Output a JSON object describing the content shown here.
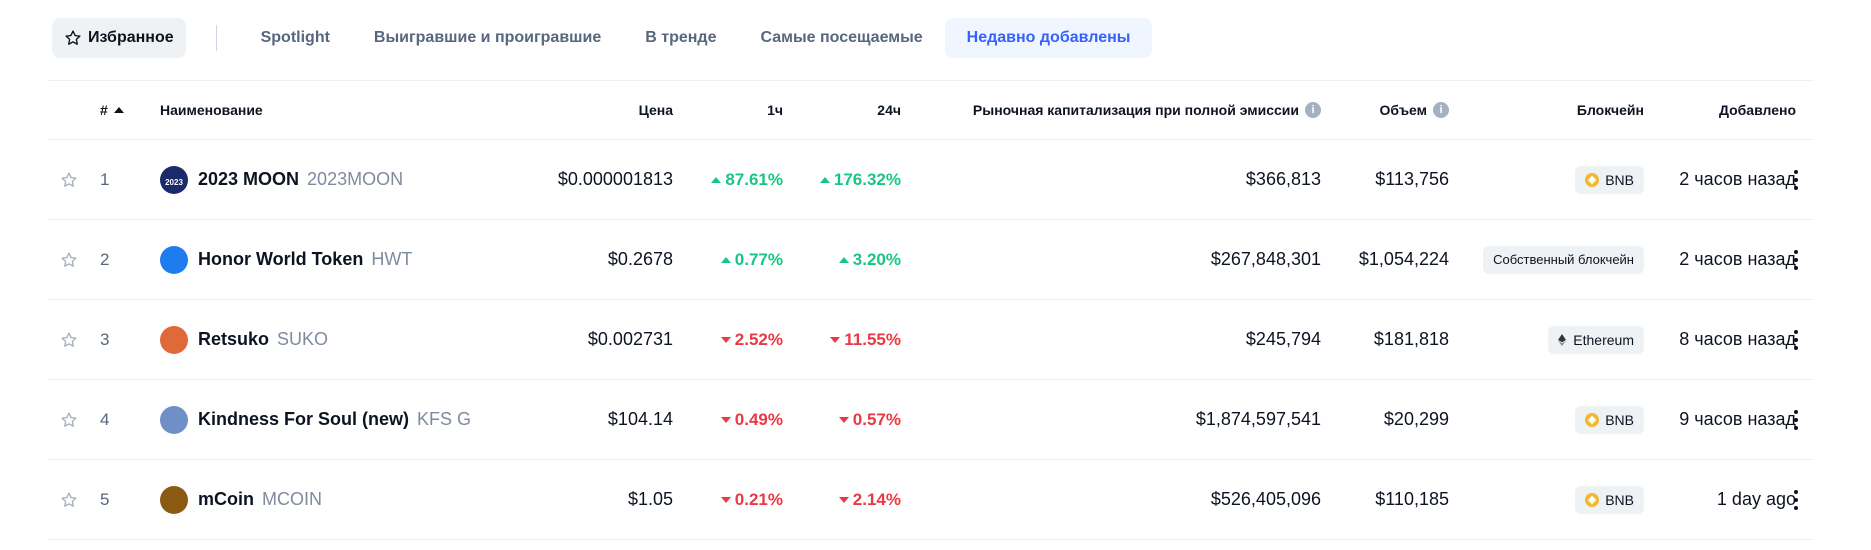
{
  "tabs": [
    {
      "label": "Избранное",
      "icon": "star-icon"
    },
    {
      "label": "Spotlight"
    },
    {
      "label": "Выигравшие и проигравшие"
    },
    {
      "label": "В тренде"
    },
    {
      "label": "Самые посещаемые"
    },
    {
      "label": "Недавно добавлены",
      "active": true
    }
  ],
  "table": {
    "headers": {
      "rank": "#",
      "name": "Наименование",
      "price": "Цена",
      "h1": "1ч",
      "h24": "24ч",
      "fdv": "Рыночная капитализация при полной эмиссии",
      "volume": "Объем",
      "blockchain": "Блокчейн",
      "added": "Добавлено"
    },
    "rows": [
      {
        "rank": "1",
        "name": "2023 MOON",
        "symbol": "2023MOON",
        "price": "$0.000001813",
        "h1": "87.61%",
        "h1_dir": "up",
        "h24": "176.32%",
        "h24_dir": "up",
        "fdv": "$366,813",
        "volume": "$113,756",
        "chain": "BNB",
        "chain_icon": "bnb-icon",
        "added": "2 часов назад",
        "icon_color": "#1a2a6b",
        "icon_text": "2023"
      },
      {
        "rank": "2",
        "name": "Honor World Token",
        "symbol": "HWT",
        "price": "$0.2678",
        "h1": "0.77%",
        "h1_dir": "up",
        "h24": "3.20%",
        "h24_dir": "up",
        "fdv": "$267,848,301",
        "volume": "$1,054,224",
        "chain": "Собственный блокчейн",
        "chain_icon": "",
        "added": "2 часов назад",
        "icon_color": "#1e7bf0",
        "icon_text": ""
      },
      {
        "rank": "3",
        "name": "Retsuko",
        "symbol": "SUKO",
        "price": "$0.002731",
        "h1": "2.52%",
        "h1_dir": "down",
        "h24": "11.55%",
        "h24_dir": "down",
        "fdv": "$245,794",
        "volume": "$181,818",
        "chain": "Ethereum",
        "chain_icon": "ethereum-icon",
        "added": "8 часов назад",
        "icon_color": "#e0693a",
        "icon_text": ""
      },
      {
        "rank": "4",
        "name": "Kindness For Soul (new)",
        "symbol": "KFS G",
        "price": "$104.14",
        "h1": "0.49%",
        "h1_dir": "down",
        "h24": "0.57%",
        "h24_dir": "down",
        "fdv": "$1,874,597,541",
        "volume": "$20,299",
        "chain": "BNB",
        "chain_icon": "bnb-icon",
        "added": "9 часов назад",
        "icon_color": "#6f8fc7",
        "icon_text": ""
      },
      {
        "rank": "5",
        "name": "mCoin",
        "symbol": "MCOIN",
        "price": "$1.05",
        "h1": "0.21%",
        "h1_dir": "down",
        "h24": "2.14%",
        "h24_dir": "down",
        "fdv": "$526,405,096",
        "volume": "$110,185",
        "chain": "BNB",
        "chain_icon": "bnb-icon",
        "added": "1 day ago",
        "icon_color": "#8a5a12",
        "icon_text": ""
      }
    ]
  },
  "colors": {
    "up": "#16c784",
    "down": "#ea3943",
    "accent": "#3861fb"
  }
}
